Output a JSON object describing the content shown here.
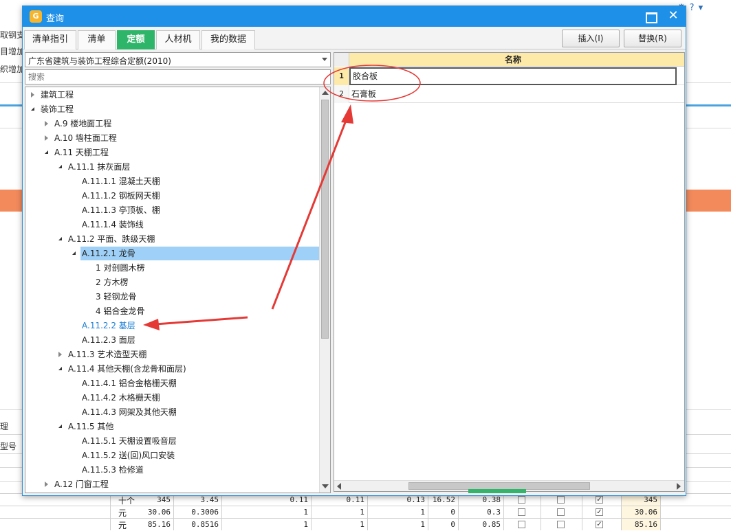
{
  "background": {
    "left_fragments": [
      "取钢支",
      "目增加",
      "织增加"
    ],
    "left_lower_fragments": [
      "理",
      "型号"
    ],
    "right_icons": [
      "gear-icon",
      "help-icon",
      "dropdown-icon"
    ],
    "help_glyph": "?",
    "table_rows": [
      {
        "unit": "十个",
        "values": [
          "345",
          "3.45",
          "0.11",
          "0.11",
          "0.13",
          "16.52",
          "0.38"
        ],
        "checks": [
          false,
          false,
          true
        ],
        "total": "345"
      },
      {
        "unit": "元",
        "values": [
          "30.06",
          "0.3006",
          "1",
          "1",
          "1",
          "0",
          "0.3"
        ],
        "checks": [
          false,
          false,
          true
        ],
        "total": "30.06"
      },
      {
        "unit": "元",
        "values": [
          "85.16",
          "0.8516",
          "1",
          "1",
          "1",
          "0",
          "0.85"
        ],
        "checks": [
          false,
          false,
          true
        ],
        "total": "85.16"
      }
    ]
  },
  "dialog": {
    "title": "查询",
    "close_glyph": "✕",
    "tabs": [
      {
        "label": "清单指引",
        "active": false
      },
      {
        "label": "清单",
        "active": false
      },
      {
        "label": "定额",
        "active": true
      },
      {
        "label": "人材机",
        "active": false
      },
      {
        "label": "我的数据",
        "active": false
      }
    ],
    "insert_label": "插入(I)",
    "replace_label": "替换(R)",
    "quota_library": "广东省建筑与装饰工程综合定额(2010)",
    "search_placeholder": "搜索",
    "tree": [
      {
        "label": "建筑工程",
        "level": 0,
        "expander": "closed"
      },
      {
        "label": "装饰工程",
        "level": 0,
        "expander": "open"
      },
      {
        "label": "A.9  楼地面工程",
        "level": 1,
        "expander": "closed"
      },
      {
        "label": "A.10  墙柱面工程",
        "level": 1,
        "expander": "closed"
      },
      {
        "label": "A.11  天棚工程",
        "level": 1,
        "expander": "open"
      },
      {
        "label": "A.11.1  抹灰面层",
        "level": 2,
        "expander": "open"
      },
      {
        "label": "A.11.1.1  混凝土天棚",
        "level": 3,
        "expander": "none"
      },
      {
        "label": "A.11.1.2  钢板网天棚",
        "level": 3,
        "expander": "none"
      },
      {
        "label": "A.11.1.3  亭顶板、棚",
        "level": 3,
        "expander": "none"
      },
      {
        "label": "A.11.1.4  装饰线",
        "level": 3,
        "expander": "none"
      },
      {
        "label": "A.11.2  平面、跌级天棚",
        "level": 2,
        "expander": "open"
      },
      {
        "label": "A.11.2.1  龙骨",
        "level": 3,
        "expander": "open",
        "selected": true
      },
      {
        "label": "1  对剖圆木楞",
        "level": 4,
        "expander": "none"
      },
      {
        "label": "2  方木楞",
        "level": 4,
        "expander": "none"
      },
      {
        "label": "3  轻钢龙骨",
        "level": 4,
        "expander": "none"
      },
      {
        "label": "4  铝合金龙骨",
        "level": 4,
        "expander": "none"
      },
      {
        "label": "A.11.2.2  基层",
        "level": 3,
        "expander": "none",
        "highlight": true
      },
      {
        "label": "A.11.2.3  面层",
        "level": 3,
        "expander": "none"
      },
      {
        "label": "A.11.3  艺术造型天棚",
        "level": 2,
        "expander": "closed"
      },
      {
        "label": "A.11.4  其他天棚(含龙骨和面层)",
        "level": 2,
        "expander": "open"
      },
      {
        "label": "A.11.4.1  铝合金格栅天棚",
        "level": 3,
        "expander": "none"
      },
      {
        "label": "A.11.4.2  木格栅天棚",
        "level": 3,
        "expander": "none"
      },
      {
        "label": "A.11.4.3  网架及其他天棚",
        "level": 3,
        "expander": "none"
      },
      {
        "label": "A.11.5  其他",
        "level": 2,
        "expander": "open"
      },
      {
        "label": "A.11.5.1  天棚设置吸音层",
        "level": 3,
        "expander": "none"
      },
      {
        "label": "A.11.5.2  送(回)风口安装",
        "level": 3,
        "expander": "none"
      },
      {
        "label": "A.11.5.3  检修道",
        "level": 3,
        "expander": "none"
      },
      {
        "label": "A.12  门窗工程",
        "level": 1,
        "expander": "closed"
      }
    ],
    "grid": {
      "header": "名称",
      "rows": [
        {
          "num": "1",
          "name": "胶合板",
          "selected": true
        },
        {
          "num": "2",
          "name": "石膏板",
          "selected": false
        }
      ]
    }
  },
  "colors": {
    "title_bar": "#1e90e8",
    "active_tab": "#2fb56a",
    "annotation_red": "#e53935",
    "selection": "#9fd0f7",
    "grid_header": "#fde9a8"
  }
}
